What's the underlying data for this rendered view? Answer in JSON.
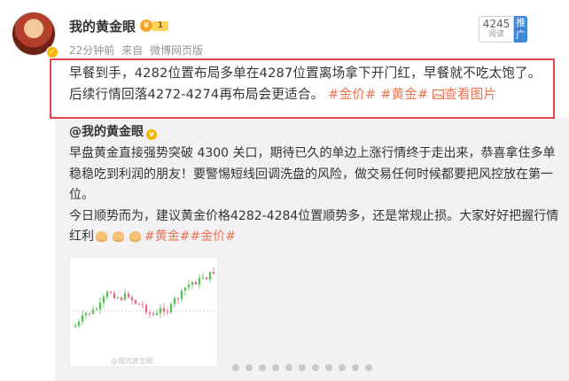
{
  "header": {
    "username": "我的黄金眼",
    "vip_level": "1",
    "time": "22分钟前",
    "source_prefix": "来自",
    "source": "微博网页版",
    "read_count": "4245",
    "read_label": "阅读",
    "promote_label": "推广"
  },
  "post": {
    "line1": "早餐到手，4282位置布局多单在4287位置离场拿下开门红，早餐就不吃太饱了。",
    "line2_text": "后续行情回落4272-4274再布局会更适合。",
    "tag1": "#金价#",
    "tag2": "#黄金#",
    "view_image": "查看图片"
  },
  "repost": {
    "author": "@我的黄金眼",
    "para1": "早盘黄金直接强势突破 4300 关口，期待已久的单边上涨行情终于走出来，恭喜拿住多单稳稳吃到利润的朋友！要警惕短线回调洗盘的风险，做交易任何时候都要把风控放在第一位。",
    "para2": "今日顺势而为，建议黄金价格4282-4284位置顺势多，还是常规止损。大家好好把握行情红利",
    "tags": "#黄金##金价#",
    "thumbnail_caption": "@我的黄金眼",
    "thumbnail_icon": "candlestick-chart-thumbnail"
  },
  "colors": {
    "highlight_border": "#e8424a",
    "topic_link": "#eb7350",
    "promote_bg": "#3f86d6",
    "gold_badge": "#f5b400",
    "candle_up": "#5bbf58",
    "candle_down": "#e46a84"
  }
}
